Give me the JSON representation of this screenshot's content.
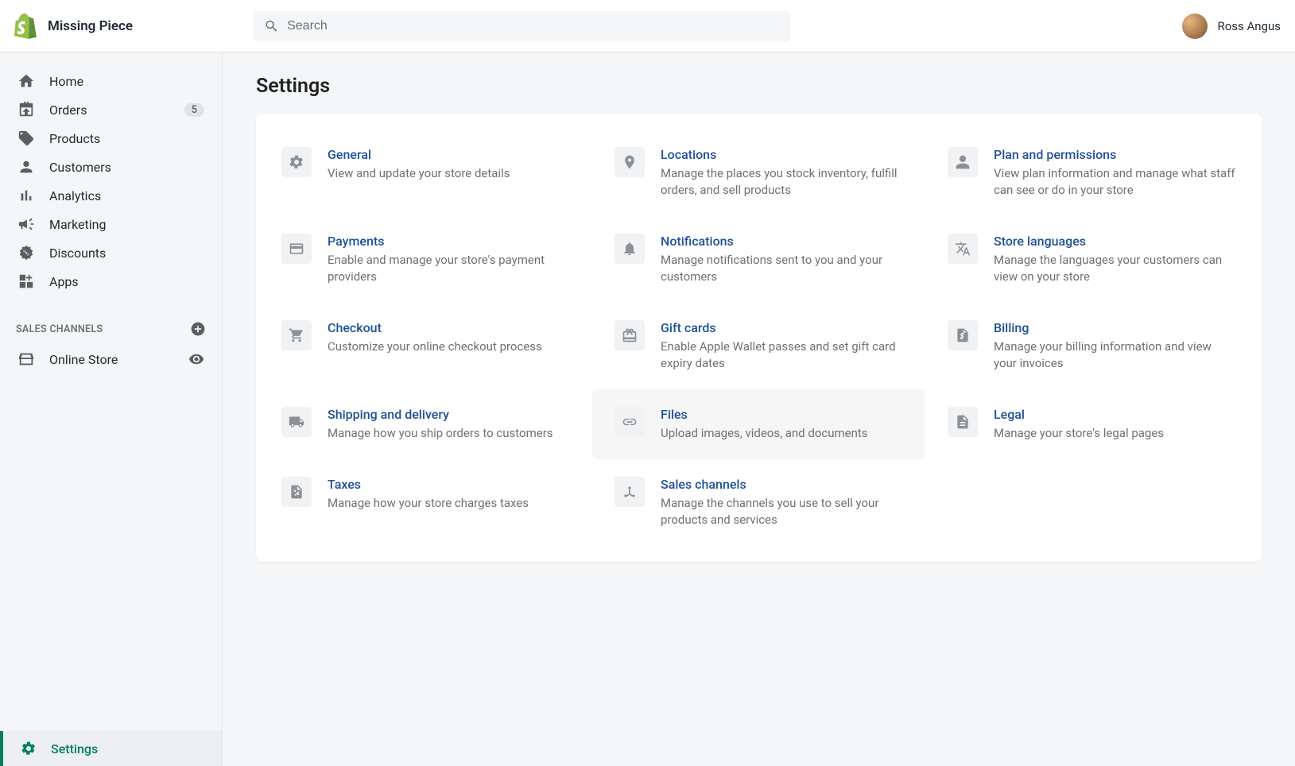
{
  "header": {
    "store_name": "Missing Piece",
    "search_placeholder": "Search",
    "user_name": "Ross Angus"
  },
  "sidebar": {
    "items": [
      {
        "label": "Home"
      },
      {
        "label": "Orders",
        "badge": "5"
      },
      {
        "label": "Products"
      },
      {
        "label": "Customers"
      },
      {
        "label": "Analytics"
      },
      {
        "label": "Marketing"
      },
      {
        "label": "Discounts"
      },
      {
        "label": "Apps"
      }
    ],
    "sales_channels_label": "SALES CHANNELS",
    "sales_channels": [
      {
        "label": "Online Store"
      }
    ],
    "settings_label": "Settings"
  },
  "page": {
    "title": "Settings",
    "items": [
      {
        "title": "General",
        "desc": "View and update your store details"
      },
      {
        "title": "Locations",
        "desc": "Manage the places you stock inventory, fulfill orders, and sell products"
      },
      {
        "title": "Plan and permissions",
        "desc": "View plan information and manage what staff can see or do in your store"
      },
      {
        "title": "Payments",
        "desc": "Enable and manage your store's payment providers"
      },
      {
        "title": "Notifications",
        "desc": "Manage notifications sent to you and your customers"
      },
      {
        "title": "Store languages",
        "desc": "Manage the languages your customers can view on your store"
      },
      {
        "title": "Checkout",
        "desc": "Customize your online checkout process"
      },
      {
        "title": "Gift cards",
        "desc": "Enable Apple Wallet passes and set gift card expiry dates"
      },
      {
        "title": "Billing",
        "desc": "Manage your billing information and view your invoices"
      },
      {
        "title": "Shipping and delivery",
        "desc": "Manage how you ship orders to customers"
      },
      {
        "title": "Files",
        "desc": "Upload images, videos, and documents"
      },
      {
        "title": "Legal",
        "desc": "Manage your store's legal pages"
      },
      {
        "title": "Taxes",
        "desc": "Manage how your store charges taxes"
      },
      {
        "title": "Sales channels",
        "desc": "Manage the channels you use to sell your products and services"
      }
    ]
  }
}
